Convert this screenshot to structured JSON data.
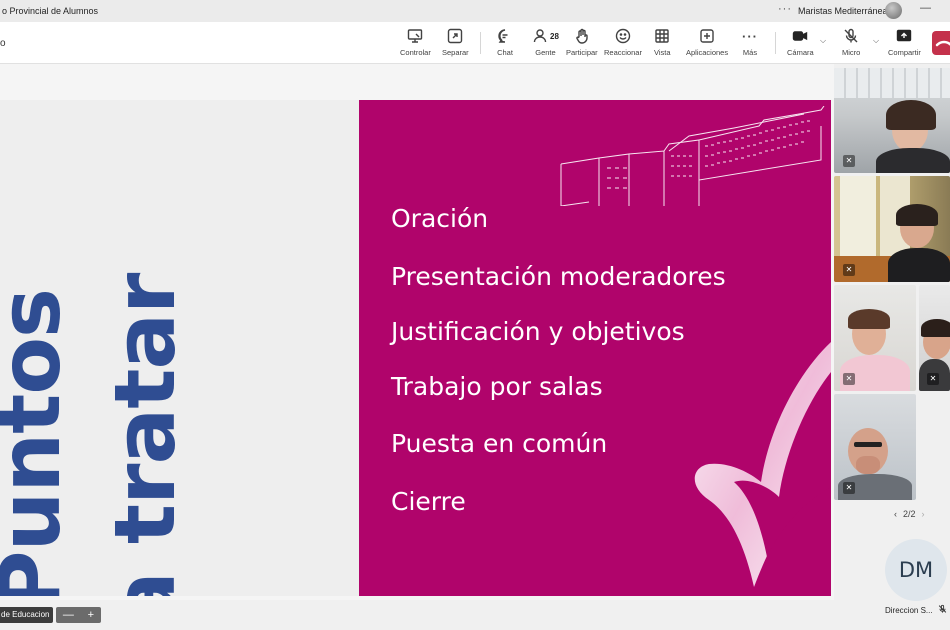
{
  "titlebar": {
    "title": "o Provincial de Alumnos",
    "more": "···",
    "org_name": "Maristas Mediterránea",
    "minimize": "—"
  },
  "toolbar": {
    "left_cut": "o",
    "controlar": "Controlar",
    "separar": "Separar",
    "chat": "Chat",
    "gente": "Gente",
    "gente_count": "28",
    "participar": "Participar",
    "reaccionar": "Reaccionar",
    "vista": "Vista",
    "aplicaciones": "Aplicaciones",
    "mas": "Más",
    "mas_icon": "···",
    "camara": "Cámara",
    "micro": "Micro",
    "compartir": "Compartir",
    "caret": "⌵"
  },
  "slide": {
    "vertical_line1": "Puntos",
    "vertical_line2": "a tratar",
    "agenda": [
      "Oración",
      "Presentación moderadores",
      "Justificación y objetivos",
      "Trabajo por salas",
      "Puesta en común",
      "Cierre"
    ],
    "colors": {
      "left_bg": "#eeeeee",
      "right_bg": "#b0046b",
      "title_color": "#2f4d92"
    }
  },
  "gallery": {
    "pager": "2/2",
    "prev": "‹",
    "next": "›",
    "avatar_initials": "DM",
    "avatar_name": "Direccion S...",
    "mic_muted_icon": "✕"
  },
  "bottombar": {
    "badge": "de Educacion",
    "zoom_out": "—",
    "zoom_in": "+"
  }
}
